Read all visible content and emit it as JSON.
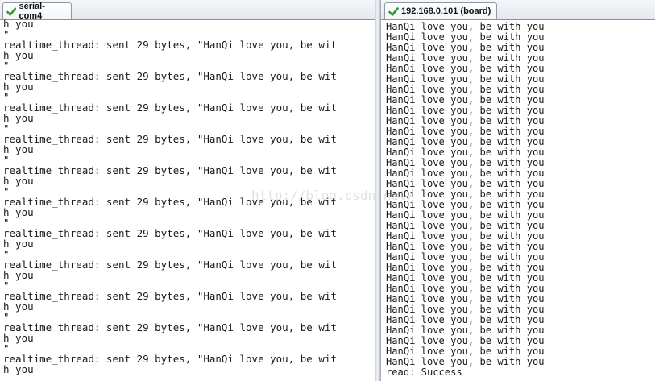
{
  "left_tab": {
    "label": "serial-com4",
    "icon": "check-icon"
  },
  "right_tab": {
    "label": "192.168.0.101 (board)",
    "icon": "check-icon"
  },
  "left_terminal": {
    "lines": [
      "h you",
      "\"",
      "realtime_thread: sent 29 bytes, \"HanQi love you, be wit",
      "h you",
      "\"",
      "realtime_thread: sent 29 bytes, \"HanQi love you, be wit",
      "h you",
      "\"",
      "realtime_thread: sent 29 bytes, \"HanQi love you, be wit",
      "h you",
      "\"",
      "realtime_thread: sent 29 bytes, \"HanQi love you, be wit",
      "h you",
      "\"",
      "realtime_thread: sent 29 bytes, \"HanQi love you, be wit",
      "h you",
      "\"",
      "realtime_thread: sent 29 bytes, \"HanQi love you, be wit",
      "h you",
      "\"",
      "realtime_thread: sent 29 bytes, \"HanQi love you, be wit",
      "h you",
      "\"",
      "realtime_thread: sent 29 bytes, \"HanQi love you, be wit",
      "h you",
      "\"",
      "realtime_thread: sent 29 bytes, \"HanQi love you, be wit",
      "h you",
      "\"",
      "realtime_thread: sent 29 bytes, \"HanQi love you, be wit",
      "h you",
      "\"",
      "realtime_thread: sent 29 bytes, \"HanQi love you, be wit",
      "h you"
    ]
  },
  "right_terminal": {
    "lines": [
      "HanQi love you, be with you",
      "HanQi love you, be with you",
      "HanQi love you, be with you",
      "HanQi love you, be with you",
      "HanQi love you, be with you",
      "HanQi love you, be with you",
      "HanQi love you, be with you",
      "HanQi love you, be with you",
      "HanQi love you, be with you",
      "HanQi love you, be with you",
      "HanQi love you, be with you",
      "HanQi love you, be with you",
      "HanQi love you, be with you",
      "HanQi love you, be with you",
      "HanQi love you, be with you",
      "HanQi love you, be with you",
      "HanQi love you, be with you",
      "HanQi love you, be with you",
      "HanQi love you, be with you",
      "HanQi love you, be with you",
      "HanQi love you, be with you",
      "HanQi love you, be with you",
      "HanQi love you, be with you",
      "HanQi love you, be with you",
      "HanQi love you, be with you",
      "HanQi love you, be with you",
      "HanQi love you, be with you",
      "HanQi love you, be with you",
      "HanQi love you, be with you",
      "HanQi love you, be with you",
      "HanQi love you, be with you",
      "HanQi love you, be with you",
      "HanQi love you, be with you",
      "read: Success"
    ]
  },
  "watermark": "http://blog.csdn.net/"
}
